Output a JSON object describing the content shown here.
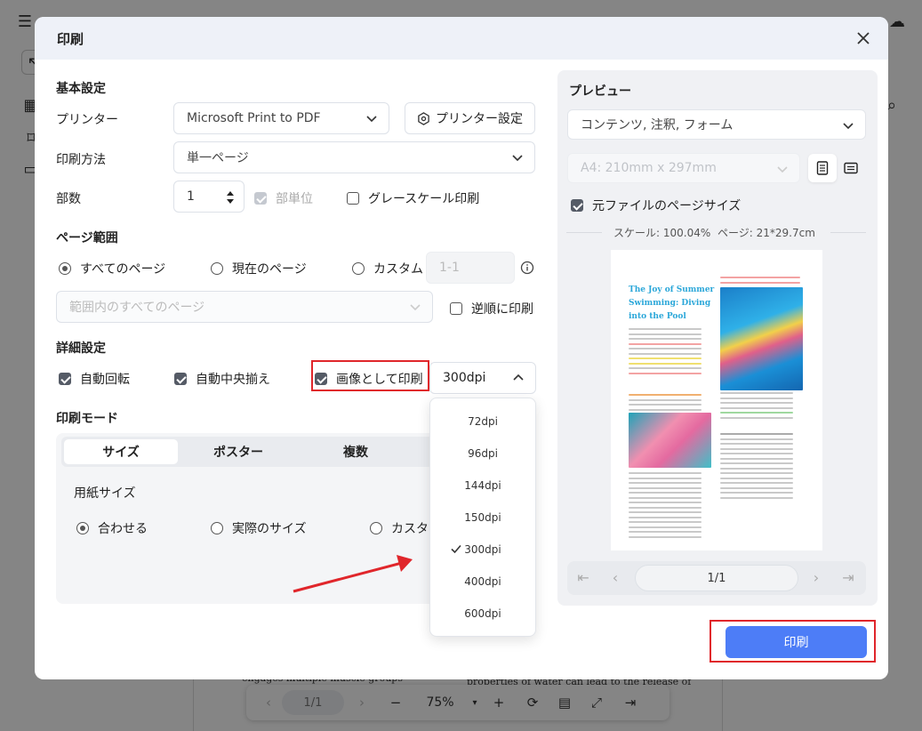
{
  "dialog": {
    "title": "印刷"
  },
  "basic": {
    "section_title": "基本設定",
    "printer_label": "プリンター",
    "printer_value": "Microsoft Print to PDF",
    "printer_settings_label": "プリンター設定",
    "print_method_label": "印刷方法",
    "print_method_value": "単一ページ",
    "copies_label": "部数",
    "copies_value": "1",
    "collate_label": "部単位",
    "grayscale_label": "グレースケール印刷"
  },
  "page_range": {
    "section_title": "ページ範囲",
    "all_pages": "すべてのページ",
    "current_page": "現在のページ",
    "custom": "カスタム",
    "custom_placeholder": "1-1",
    "subset_value": "範囲内のすべてのページ",
    "reverse_label": "逆順に印刷"
  },
  "advanced": {
    "section_title": "詳細設定",
    "auto_rotate": "自動回転",
    "auto_center": "自動中央揃え",
    "print_as_image": "画像として印刷",
    "dpi_value": "300dpi",
    "dpi_options": [
      "72dpi",
      "96dpi",
      "144dpi",
      "150dpi",
      "300dpi",
      "400dpi",
      "600dpi"
    ],
    "dpi_selected": "300dpi"
  },
  "print_mode": {
    "section_title": "印刷モード",
    "tabs": [
      "サイズ",
      "ポスター",
      "複数"
    ],
    "paper_size_label": "用紙サイズ",
    "fit": "合わせる",
    "actual_size": "実際のサイズ",
    "custom": "カスタ"
  },
  "preview": {
    "title": "プレビュー",
    "content_value": "コンテンツ, 注釈, フォーム",
    "paper_value": "A4: 210mm x 297mm",
    "original_size_label": "元ファイルのページサイズ",
    "scale_text": "スケール: 100.04%",
    "page_size_text": "ページ: 21*29.7cm",
    "page_indicator": "1/1",
    "doc_title": "The Joy of Summer Swimming: Diving into the Pool"
  },
  "print_button": "印刷",
  "background": {
    "doc_text_left": "engages multiple muscle groups",
    "doc_text_right": "properties of water can lead to the release of",
    "page_indicator": "1/1",
    "zoom": "75%"
  },
  "colors": {
    "accent": "#4d7df7",
    "highlight_box": "#e0262b",
    "arrow": "#e0262b"
  }
}
